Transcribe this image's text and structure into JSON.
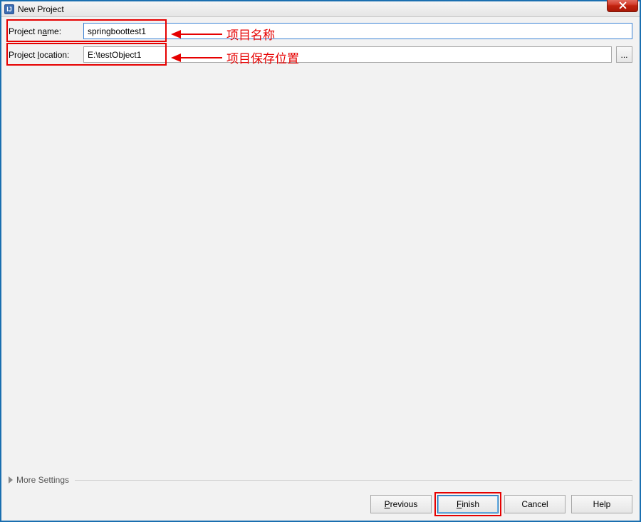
{
  "window": {
    "title": "New Project",
    "icon_letter": "IJ"
  },
  "form": {
    "project_name_label": "Project name:",
    "project_name_value": "springboottest1",
    "project_location_label": "Project location:",
    "project_location_value": "E:\\testObject1",
    "browse_button": "..."
  },
  "annotations": {
    "project_name": "项目名称",
    "project_location": "项目保存位置"
  },
  "more_settings": {
    "label": "More Settings"
  },
  "buttons": {
    "previous": "Previous",
    "finish": "Finish",
    "cancel": "Cancel",
    "help": "Help"
  }
}
